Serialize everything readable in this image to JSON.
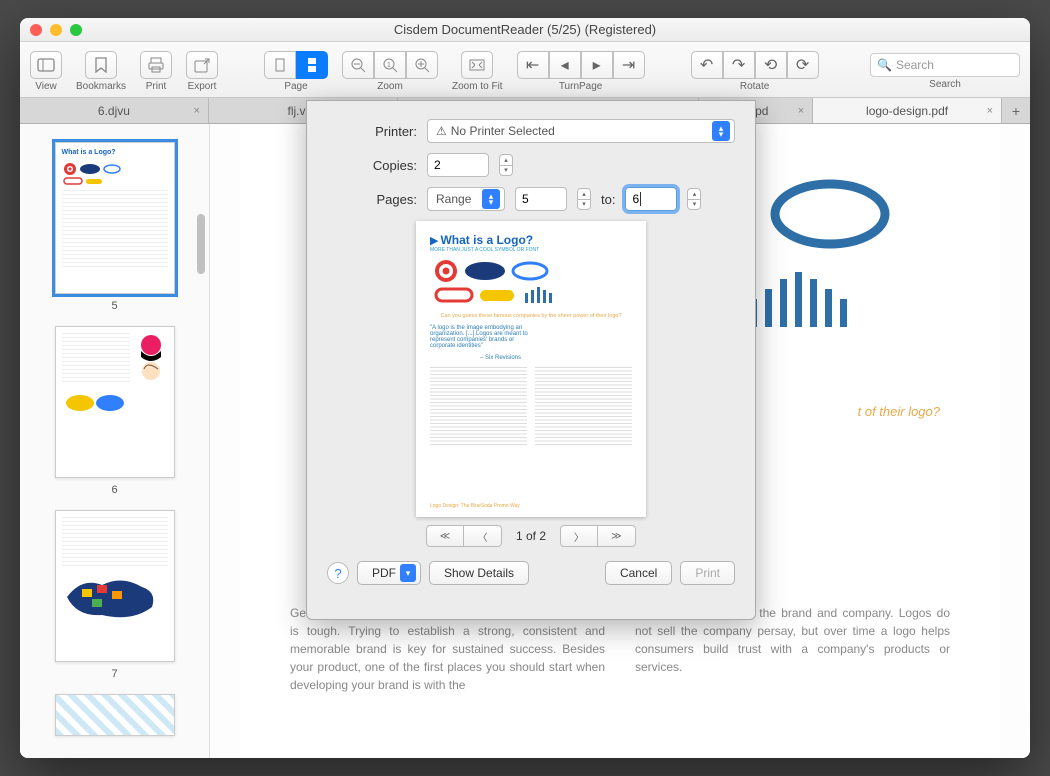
{
  "window": {
    "title": "Cisdem DocumentReader (5/25) (Registered)"
  },
  "toolbar": {
    "view": "View",
    "bookmarks": "Bookmarks",
    "print": "Print",
    "export": "Export",
    "page": "Page",
    "zoom": "Zoom",
    "zoom_fit": "Zoom to Fit",
    "turnpage": "TurnPage",
    "rotate": "Rotate",
    "search": "Search",
    "search_placeholder": "Search"
  },
  "tabs": [
    {
      "label": "6.djvu",
      "active": false
    },
    {
      "label": "flj.vsd",
      "active": false
    },
    {
      "label": "",
      "active": false,
      "hidden": true
    },
    {
      "label": ".wpd",
      "active": false
    },
    {
      "label": "logo-design.pdf",
      "active": true
    }
  ],
  "thumbnails": [
    {
      "num": "5",
      "selected": true
    },
    {
      "num": "6",
      "selected": false
    },
    {
      "num": "7",
      "selected": false
    }
  ],
  "page": {
    "caption": "t of their logo?",
    "quote_author": "– Six Revisions",
    "col1": "Getting noticed as a new business in today's digital world is tough. Trying to establish a strong, consistent and memorable brand is key for sustained success. Besides your product, one of the first places you should start when developing your brand is with the",
    "col2": "represent the story of the brand and company. Logos do not sell the company persay, but over time a logo helps consumers build trust with a company's products or services."
  },
  "dialog": {
    "printer_label": "Printer:",
    "printer_value": "No Printer Selected",
    "copies_label": "Copies:",
    "copies_value": "2",
    "pages_label": "Pages:",
    "pages_mode": "Range",
    "pages_from": "5",
    "pages_to_label": "to:",
    "pages_to": "6",
    "preview_title": "What is a Logo?",
    "preview_sub": "MORE THAN JUST A COOL SYMBOL OR FONT",
    "preview_quote": "\"A logo is the image embodying an organization. [...] Logos are meant to represent companies' brands or corporate identities\"",
    "preview_author": "– Six Revisions",
    "preview_footer": "Logo Design: The BlueSoda Promo Way",
    "pagenav": "1 of 2",
    "help": "?",
    "pdf_btn": "PDF",
    "details_btn": "Show Details",
    "cancel_btn": "Cancel",
    "print_btn": "Print"
  }
}
